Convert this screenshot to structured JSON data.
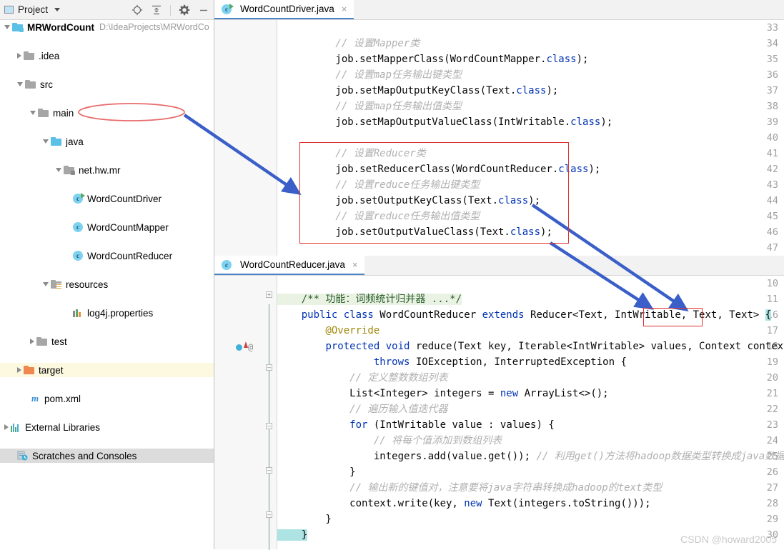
{
  "project_panel": {
    "title": "Project",
    "toolbar_icons": [
      "locate-icon",
      "collapse-all-icon",
      "settings-gear-icon",
      "minimize-icon"
    ],
    "tree": [
      {
        "label": "MRWordCount",
        "path": "D:\\IdeaProjects\\MRWordCo",
        "icon": "module-folder-icon",
        "state": "open",
        "indent": 0,
        "bold": true
      },
      {
        "label": ".idea",
        "icon": "folder-icon",
        "state": "closed",
        "indent": 1
      },
      {
        "label": "src",
        "icon": "folder-icon",
        "state": "open",
        "indent": 1
      },
      {
        "label": "main",
        "icon": "folder-icon",
        "state": "open",
        "indent": 2
      },
      {
        "label": "java",
        "icon": "source-folder-icon",
        "state": "open",
        "indent": 3
      },
      {
        "label": "net.hw.mr",
        "icon": "package-folder-icon",
        "state": "open",
        "indent": 4
      },
      {
        "label": "WordCountDriver",
        "icon": "java-class-runnable-icon",
        "state": "leaf",
        "indent": 5,
        "circled": true
      },
      {
        "label": "WordCountMapper",
        "icon": "java-class-icon",
        "state": "leaf",
        "indent": 5
      },
      {
        "label": "WordCountReducer",
        "icon": "java-class-icon",
        "state": "leaf",
        "indent": 5
      },
      {
        "label": "resources",
        "icon": "resources-folder-icon",
        "state": "open",
        "indent": 3
      },
      {
        "label": "log4j.properties",
        "icon": "properties-file-icon",
        "state": "leaf",
        "indent": 4
      },
      {
        "label": "test",
        "icon": "folder-icon",
        "state": "closed",
        "indent": 2
      },
      {
        "label": "target",
        "icon": "excluded-folder-icon",
        "state": "closed",
        "indent": 1,
        "highlight": "yellow"
      },
      {
        "label": "pom.xml",
        "icon": "maven-file-icon",
        "state": "leaf",
        "indent": 1
      },
      {
        "label": "External Libraries",
        "icon": "libraries-icon",
        "state": "closed",
        "indent": 0
      },
      {
        "label": "Scratches and Consoles",
        "icon": "scratches-icon",
        "state": "leaf",
        "indent": 0,
        "highlight": "gray"
      }
    ]
  },
  "editor_top": {
    "tab": {
      "label": "WordCountDriver.java",
      "icon": "java-class-runnable-icon",
      "close": "×"
    },
    "first_line": 33,
    "lines": [
      {
        "n": 33,
        "segs": []
      },
      {
        "n": 34,
        "segs": [
          {
            "t": "        // 设置Mapper类",
            "c": "cmt"
          }
        ]
      },
      {
        "n": 35,
        "segs": [
          {
            "t": "        job.setMapperClass(WordCountMapper.",
            "c": ""
          },
          {
            "t": "class",
            "c": "kw"
          },
          {
            "t": ");",
            "c": ""
          }
        ]
      },
      {
        "n": 36,
        "segs": [
          {
            "t": "        // 设置map任务输出键类型",
            "c": "cmt"
          }
        ]
      },
      {
        "n": 37,
        "segs": [
          {
            "t": "        job.setMapOutputKeyClass(Text.",
            "c": ""
          },
          {
            "t": "class",
            "c": "kw"
          },
          {
            "t": ");",
            "c": ""
          }
        ]
      },
      {
        "n": 38,
        "segs": [
          {
            "t": "        // 设置map任务输出值类型",
            "c": "cmt"
          }
        ]
      },
      {
        "n": 39,
        "segs": [
          {
            "t": "        job.setMapOutputValueClass(IntWritable.",
            "c": ""
          },
          {
            "t": "class",
            "c": "kw"
          },
          {
            "t": ");",
            "c": ""
          }
        ]
      },
      {
        "n": 40,
        "segs": []
      },
      {
        "n": 41,
        "segs": [
          {
            "t": "        // 设置Reducer类",
            "c": "cmt"
          }
        ]
      },
      {
        "n": 42,
        "segs": [
          {
            "t": "        job.setReducerClass(WordCountReducer.",
            "c": ""
          },
          {
            "t": "class",
            "c": "kw"
          },
          {
            "t": ");",
            "c": ""
          }
        ]
      },
      {
        "n": 43,
        "segs": [
          {
            "t": "        // 设置reduce任务输出键类型",
            "c": "cmt"
          }
        ]
      },
      {
        "n": 44,
        "segs": [
          {
            "t": "        job.setOutputKeyClass(Text.",
            "c": ""
          },
          {
            "t": "class",
            "c": "kw"
          },
          {
            "t": ");",
            "c": ""
          }
        ]
      },
      {
        "n": 45,
        "segs": [
          {
            "t": "        // 设置reduce任务输出值类型",
            "c": "cmt"
          }
        ]
      },
      {
        "n": 46,
        "segs": [
          {
            "t": "        job.setOutputValueClass(Text.",
            "c": ""
          },
          {
            "t": "class",
            "c": "kw"
          },
          {
            "t": ");",
            "c": ""
          }
        ]
      },
      {
        "n": 47,
        "segs": []
      }
    ]
  },
  "editor_bottom": {
    "tab": {
      "label": "WordCountReducer.java",
      "icon": "java-class-icon",
      "close": "×"
    },
    "lines": [
      {
        "n": 10,
        "segs": []
      },
      {
        "n": 11,
        "segs": [
          {
            "t": "    /** 功能：词频统计归并器 ...*/",
            "c": "doc hl-doc"
          }
        ]
      },
      {
        "n": 16,
        "segs": [
          {
            "t": "    ",
            "c": ""
          },
          {
            "t": "public class",
            "c": "kw"
          },
          {
            "t": " WordCountReducer ",
            "c": ""
          },
          {
            "t": "extends",
            "c": "kw"
          },
          {
            "t": " Reducer<Text, IntWritable, Text, Text> ",
            "c": ""
          },
          {
            "t": "{",
            "c": "caret-block"
          }
        ]
      },
      {
        "n": 17,
        "segs": [
          {
            "t": "        @Override",
            "c": "ann"
          }
        ]
      },
      {
        "n": 18,
        "segs": [
          {
            "t": "        ",
            "c": ""
          },
          {
            "t": "protected void",
            "c": "kw"
          },
          {
            "t": " ",
            "c": ""
          },
          {
            "t": "reduce",
            "c": "fn"
          },
          {
            "t": "(Text key, Iterable<IntWritable> values, Context context)",
            "c": ""
          }
        ]
      },
      {
        "n": 19,
        "segs": [
          {
            "t": "                ",
            "c": ""
          },
          {
            "t": "throws",
            "c": "kw"
          },
          {
            "t": " IOException, InterruptedException {",
            "c": ""
          }
        ]
      },
      {
        "n": 20,
        "segs": [
          {
            "t": "            // 定义整数数组列表",
            "c": "cmt"
          }
        ]
      },
      {
        "n": 21,
        "segs": [
          {
            "t": "            List<Integer> integers = ",
            "c": ""
          },
          {
            "t": "new",
            "c": "kw"
          },
          {
            "t": " ArrayList<>();",
            "c": ""
          }
        ]
      },
      {
        "n": 22,
        "segs": [
          {
            "t": "            // 遍历输入值迭代器",
            "c": "cmt"
          }
        ]
      },
      {
        "n": 23,
        "segs": [
          {
            "t": "            ",
            "c": ""
          },
          {
            "t": "for",
            "c": "kw"
          },
          {
            "t": " (IntWritable value : values) {",
            "c": ""
          }
        ]
      },
      {
        "n": 24,
        "segs": [
          {
            "t": "                // 将每个值添加到数组列表",
            "c": "cmt"
          }
        ]
      },
      {
        "n": 25,
        "segs": [
          {
            "t": "                integers.add(value.get()); ",
            "c": ""
          },
          {
            "t": "// 利用get()方法将hadoop数据类型转换成java数据类型",
            "c": "cmt"
          }
        ]
      },
      {
        "n": 26,
        "segs": [
          {
            "t": "            }",
            "c": ""
          }
        ]
      },
      {
        "n": 27,
        "segs": [
          {
            "t": "            // 输出新的键值对，注意要将java字符串转换成hadoop的text类型",
            "c": "cmt"
          }
        ]
      },
      {
        "n": 28,
        "segs": [
          {
            "t": "            context.write(key, ",
            "c": ""
          },
          {
            "t": "new",
            "c": "kw"
          },
          {
            "t": " Text(integers.toString()));",
            "c": ""
          }
        ]
      },
      {
        "n": 29,
        "segs": [
          {
            "t": "        }",
            "c": ""
          }
        ]
      },
      {
        "n": 30,
        "segs": [
          {
            "t": "    }",
            "c": "caret-block"
          }
        ]
      }
    ]
  },
  "annotations": {
    "ellipse_target": "WordCountDriver",
    "red_box_top_label": "reducer-settings-block",
    "red_box_bottom_label": "Text, Text",
    "arrow_color": "#3a5fc8",
    "ellipse_color": "#e86a6a",
    "box_color": "#e03030"
  },
  "watermark": "CSDN @howard2005"
}
